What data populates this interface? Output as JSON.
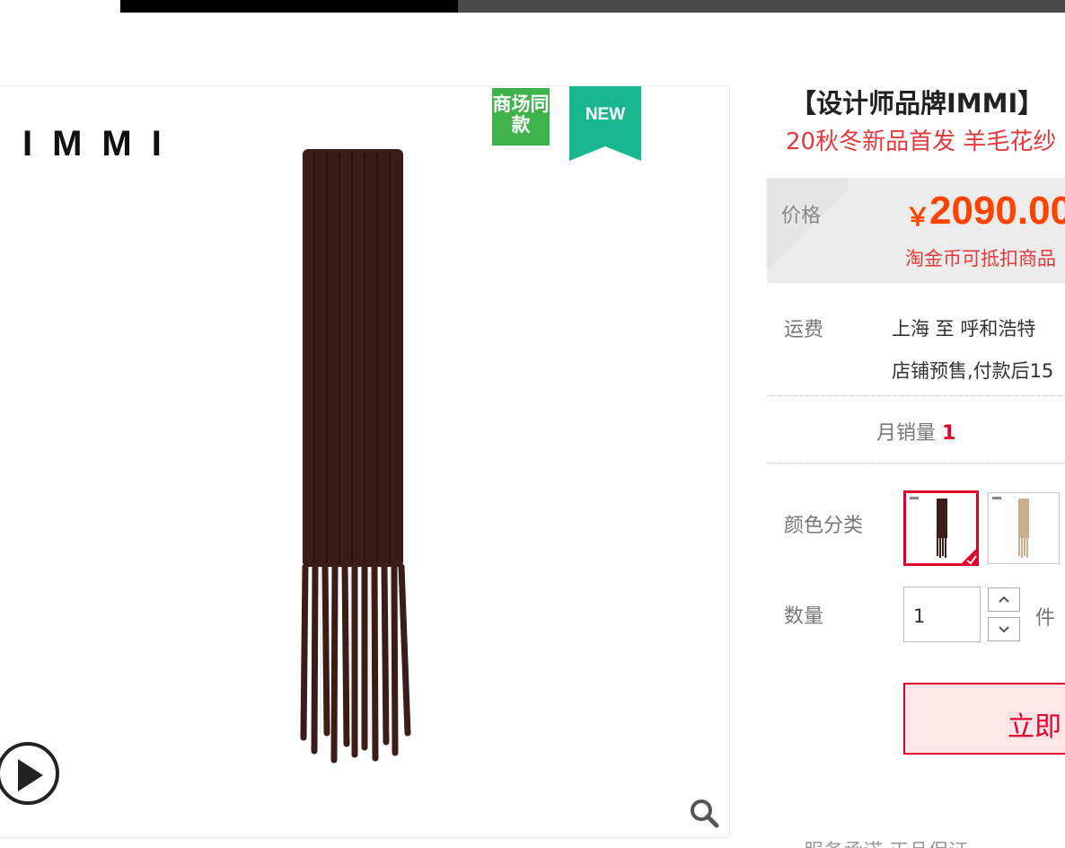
{
  "topbar": {},
  "gallery": {
    "brand_logo": "IMMI",
    "badge_mall": "商场同款",
    "badge_new": "NEW"
  },
  "product": {
    "title": "【设计师品牌IMMI】",
    "subtitle": "20秋冬新品首发 羊毛花纱",
    "price_label": "价格",
    "currency": "￥",
    "price": "2090.00",
    "price_note": "淘金币可抵扣商品",
    "shipping_label": "运费",
    "shipping_route": "上海  至  呼和浩特",
    "shipping_presale": "店铺预售,付款后15",
    "sales_label": "月销量",
    "sales_count": "1",
    "color_label": "颜色分类",
    "quantity_label": "数量",
    "quantity_value": "1",
    "quantity_unit": "件",
    "buy_now": "立即",
    "service_label": "服务承诺     正品保证"
  },
  "colors": {
    "brand_red": "#e4002b",
    "price_orange": "#ff4400",
    "badge_green": "#3fb24c",
    "new_teal": "#18b78d",
    "scarf_brown": "#3b1c16",
    "scarf_beige": "#c9ad8c"
  },
  "icons": {
    "play": "play-icon",
    "zoom": "magnifier-icon",
    "check": "check-icon",
    "up": "chevron-up-icon",
    "down": "chevron-down-icon"
  }
}
